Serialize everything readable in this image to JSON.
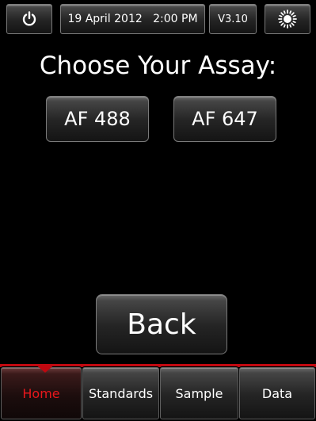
{
  "status_bar": {
    "power_icon": "power-icon",
    "datetime": "19 April 2012   2:00 PM",
    "version": "V3.10",
    "brightness_icon": "sun-icon"
  },
  "main": {
    "title": "Choose Your Assay:",
    "assays": [
      {
        "label": "AF 488"
      },
      {
        "label": "AF 647"
      }
    ],
    "back_label": "Back"
  },
  "nav": {
    "active": "Home",
    "active_color": "#e8171c",
    "accent_color": "#c00810",
    "items": [
      {
        "label": "Home"
      },
      {
        "label": "Standards"
      },
      {
        "label": "Sample"
      },
      {
        "label": "Data"
      }
    ]
  }
}
